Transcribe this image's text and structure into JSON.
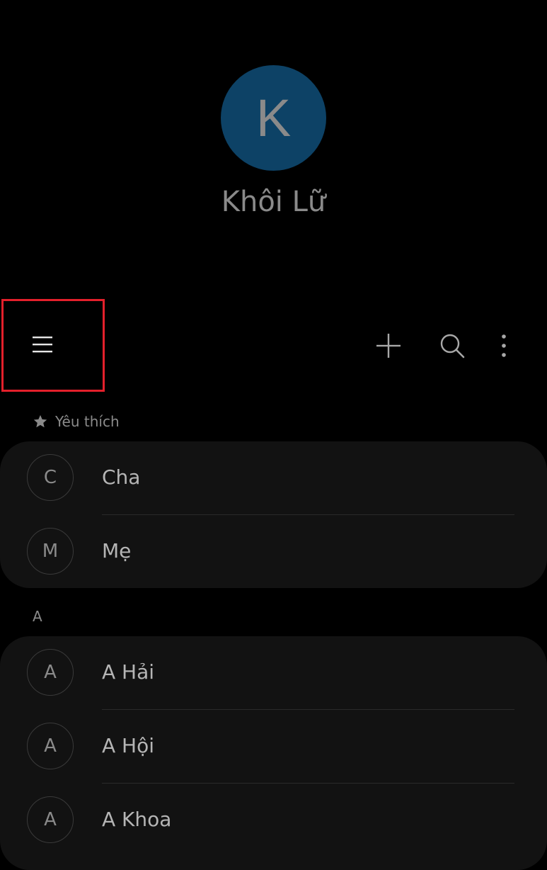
{
  "profile": {
    "initial": "K",
    "name": "Khôi Lữ",
    "avatar_color": "#0d4266"
  },
  "toolbar": {
    "menu_icon": "hamburger-menu-icon",
    "add_icon": "plus-icon",
    "search_icon": "search-icon",
    "more_icon": "more-vertical-icon",
    "highlight_color": "#e3202b"
  },
  "favorites": {
    "header": "Yêu thích",
    "icon": "star-icon",
    "contacts": [
      {
        "initial": "C",
        "name": "Cha"
      },
      {
        "initial": "M",
        "name": "Mẹ"
      }
    ]
  },
  "section_a": {
    "header": "A",
    "contacts": [
      {
        "initial": "A",
        "name": "A Hải"
      },
      {
        "initial": "A",
        "name": "A Hội"
      },
      {
        "initial": "A",
        "name": "A Khoa"
      }
    ]
  }
}
